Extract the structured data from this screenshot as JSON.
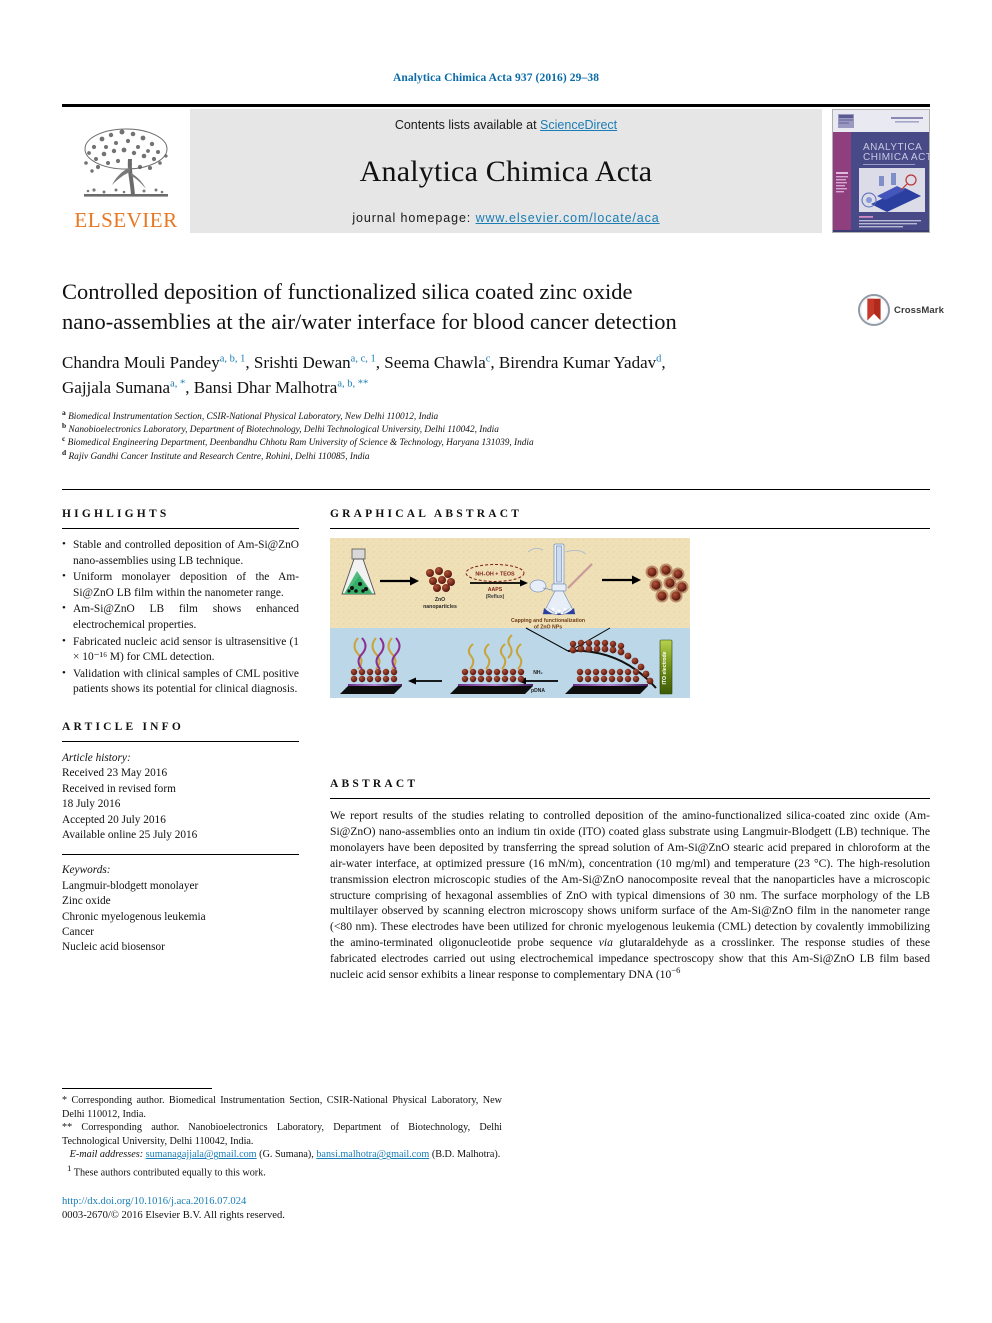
{
  "running_head": "Analytica Chimica Acta 937 (2016) 29–38",
  "masthead": {
    "contents_prefix": "Contents lists available at ",
    "sciencedirect": "ScienceDirect",
    "journal_title": "Analytica Chimica Acta",
    "homepage_prefix": "journal homepage: ",
    "homepage_url": "www.elsevier.com/locate/aca",
    "publisher": "ELSEVIER",
    "publisher_color": "#E87722",
    "link_color": "#1a7db5",
    "band_color": "#e6e6e6",
    "cover_alt": "Analytica Chimica Acta journal cover"
  },
  "article": {
    "title_line1": "Controlled deposition of functionalized silica coated zinc oxide",
    "title_line2": "nano-assemblies at the air/water interface for blood cancer detection",
    "crossmark_label": "CrossMark",
    "authors": [
      {
        "name": "Chandra Mouli Pandey",
        "marks": "a, b, 1",
        "sep": ", "
      },
      {
        "name": "Srishti Dewan",
        "marks": "a, c, 1",
        "sep": ", "
      },
      {
        "name": "Seema Chawla",
        "marks": "c",
        "sep": ", "
      },
      {
        "name": "Birendra Kumar Yadav",
        "marks": "d",
        "sep": ", "
      },
      {
        "name": "Gajjala Sumana",
        "marks": "a, *",
        "sep": ", "
      },
      {
        "name": "Bansi Dhar Malhotra",
        "marks": "a, b, **",
        "sep": ""
      }
    ],
    "affiliations": [
      {
        "mark": "a",
        "text": "Biomedical Instrumentation Section, CSIR-National Physical Laboratory, New Delhi 110012, India"
      },
      {
        "mark": "b",
        "text": "Nanobioelectronics Laboratory, Department of Biotechnology, Delhi Technological University, Delhi 110042, India"
      },
      {
        "mark": "c",
        "text": "Biomedical Engineering Department, Deenbandhu Chhotu Ram University of Science & Technology, Haryana 131039, India"
      },
      {
        "mark": "d",
        "text": "Rajiv Gandhi Cancer Institute and Research Centre, Rohini, Delhi 110085, India"
      }
    ]
  },
  "highlights": {
    "heading": "HIGHLIGHTS",
    "items": [
      "Stable and controlled deposition of Am-Si@ZnO nano-assemblies using LB technique.",
      "Uniform monolayer deposition of the Am-Si@ZnO LB film within the nanometer range.",
      "Am-Si@ZnO LB film shows enhanced electrochemical properties.",
      "Fabricated nucleic acid sensor is ultrasensitive (1 × 10⁻¹⁶ M) for CML detection.",
      "Validation with clinical samples of CML positive patients shows its potential for clinical diagnosis."
    ]
  },
  "graphical_abstract": {
    "heading": "GRAPHICAL ABSTRACT",
    "labels": {
      "zno_nanoparticles": "ZnO nanoparticles",
      "reagents": "NH₄OH + TEOS",
      "reagents2": "AAPS",
      "reflux": "(Reflux)",
      "capping": "Capping and functionalization of ZnO NPs",
      "ito_electrode": "ITO electrode",
      "nh2": "NH₂",
      "pdna": "pDNA"
    }
  },
  "article_info": {
    "heading": "ARTICLE INFO",
    "history_label": "Article history:",
    "history": [
      "Received 23 May 2016",
      "Received in revised form",
      "18 July 2016",
      "Accepted 20 July 2016",
      "Available online 25 July 2016"
    ],
    "keywords_label": "Keywords:",
    "keywords": [
      "Langmuir-blodgett monolayer",
      "Zinc oxide",
      "Chronic myelogenous leukemia",
      "Cancer",
      "Nucleic acid biosensor"
    ]
  },
  "abstract": {
    "heading": "ABSTRACT",
    "body_part1": "We report results of the studies relating to controlled deposition of the amino-functionalized silica-coated zinc oxide (Am-Si@ZnO) nano-assemblies onto an indium tin oxide (ITO) coated glass substrate using Langmuir-Blodgett (LB) technique. The monolayers have been deposited by transferring the spread solution of Am-Si@ZnO stearic acid prepared in chloroform at the air-water interface, at optimized pressure (16 mN/m), concentration (10 mg/ml) and temperature (23 °C). The high-resolution transmission electron microscopic studies of the Am-Si@ZnO nanocomposite reveal that the nanoparticles have a microscopic structure comprising of hexagonal assemblies of ZnO with typical dimensions of 30 nm. The surface morphology of the LB multilayer observed by scanning electron microscopy shows uniform surface of the Am-Si@ZnO film in the nanometer range (<80 nm). These electrodes have been utilized for chronic myelogenous leukemia (CML) detection by covalently immobilizing the amino-terminated oligonucleotide probe sequence ",
    "via_italic": "via",
    "body_part2": " glutaraldehyde as a crosslinker. The response studies of these fabricated electrodes carried out using electrochemical impedance spectroscopy show that this Am-Si@ZnO LB film based nucleic acid sensor exhibits a linear response to complementary DNA (10",
    "superscript_tail": "−6"
  },
  "footnotes": {
    "corresponding1": "* Corresponding author. Biomedical Instrumentation Section, CSIR-National Physical Laboratory, New Delhi 110012, India.",
    "corresponding2": "** Corresponding author. Nanobioelectronics Laboratory, Department of Biotechnology, Delhi Technological University, Delhi 110042, India.",
    "email_label": "E-mail addresses:",
    "email1": "sumanagajjala@gmail.com",
    "email1_owner": " (G. Sumana), ",
    "email2": "bansi.malhotra@gmail.com",
    "email2_owner": " (B.D. Malhotra).",
    "equal_contrib_mark": "1",
    "equal_contrib": "These authors contributed equally to this work.",
    "doi": "http://dx.doi.org/10.1016/j.aca.2016.07.024",
    "copyright": "0003-2670/© 2016 Elsevier B.V. All rights reserved."
  }
}
